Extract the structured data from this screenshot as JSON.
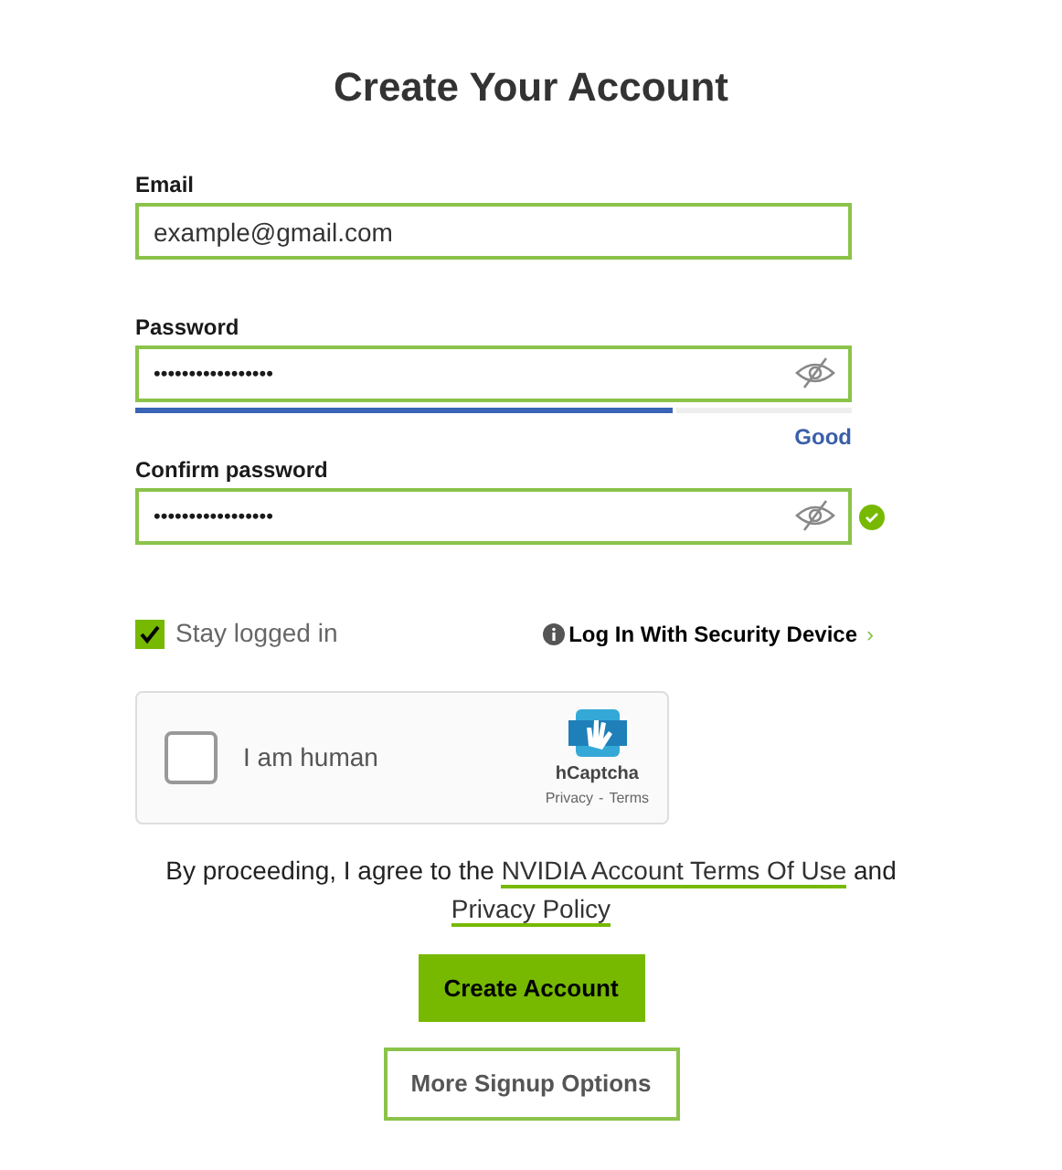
{
  "title": "Create Your Account",
  "email": {
    "label": "Email",
    "value": "example@gmail.com"
  },
  "password": {
    "label": "Password",
    "value": "•••••••••••••••••",
    "strength": {
      "level": 0.75,
      "label": "Good"
    }
  },
  "confirm_password": {
    "label": "Confirm password",
    "value": "•••••••••••••••••",
    "matched": true
  },
  "stay_logged_in": {
    "label": "Stay logged in",
    "checked": true
  },
  "security_device_link": {
    "label": "Log In With Security Device",
    "chevron": "›"
  },
  "captcha": {
    "label": "I am human",
    "checked": false,
    "brand": "hCaptcha",
    "privacy": "Privacy",
    "separator": "-",
    "terms": "Terms"
  },
  "agreement": [
    {
      "kind": "text",
      "text": "By proceeding, I agree to the"
    },
    {
      "kind": "link",
      "text": "NVIDIA Account Terms Of Use"
    },
    {
      "kind": "text",
      "text": "and"
    },
    {
      "kind": "link",
      "text": "Privacy Policy"
    }
  ],
  "buttons": [
    {
      "label": "Create Account",
      "kind": "primary"
    },
    {
      "label": "More Signup Options",
      "kind": "outline"
    }
  ]
}
